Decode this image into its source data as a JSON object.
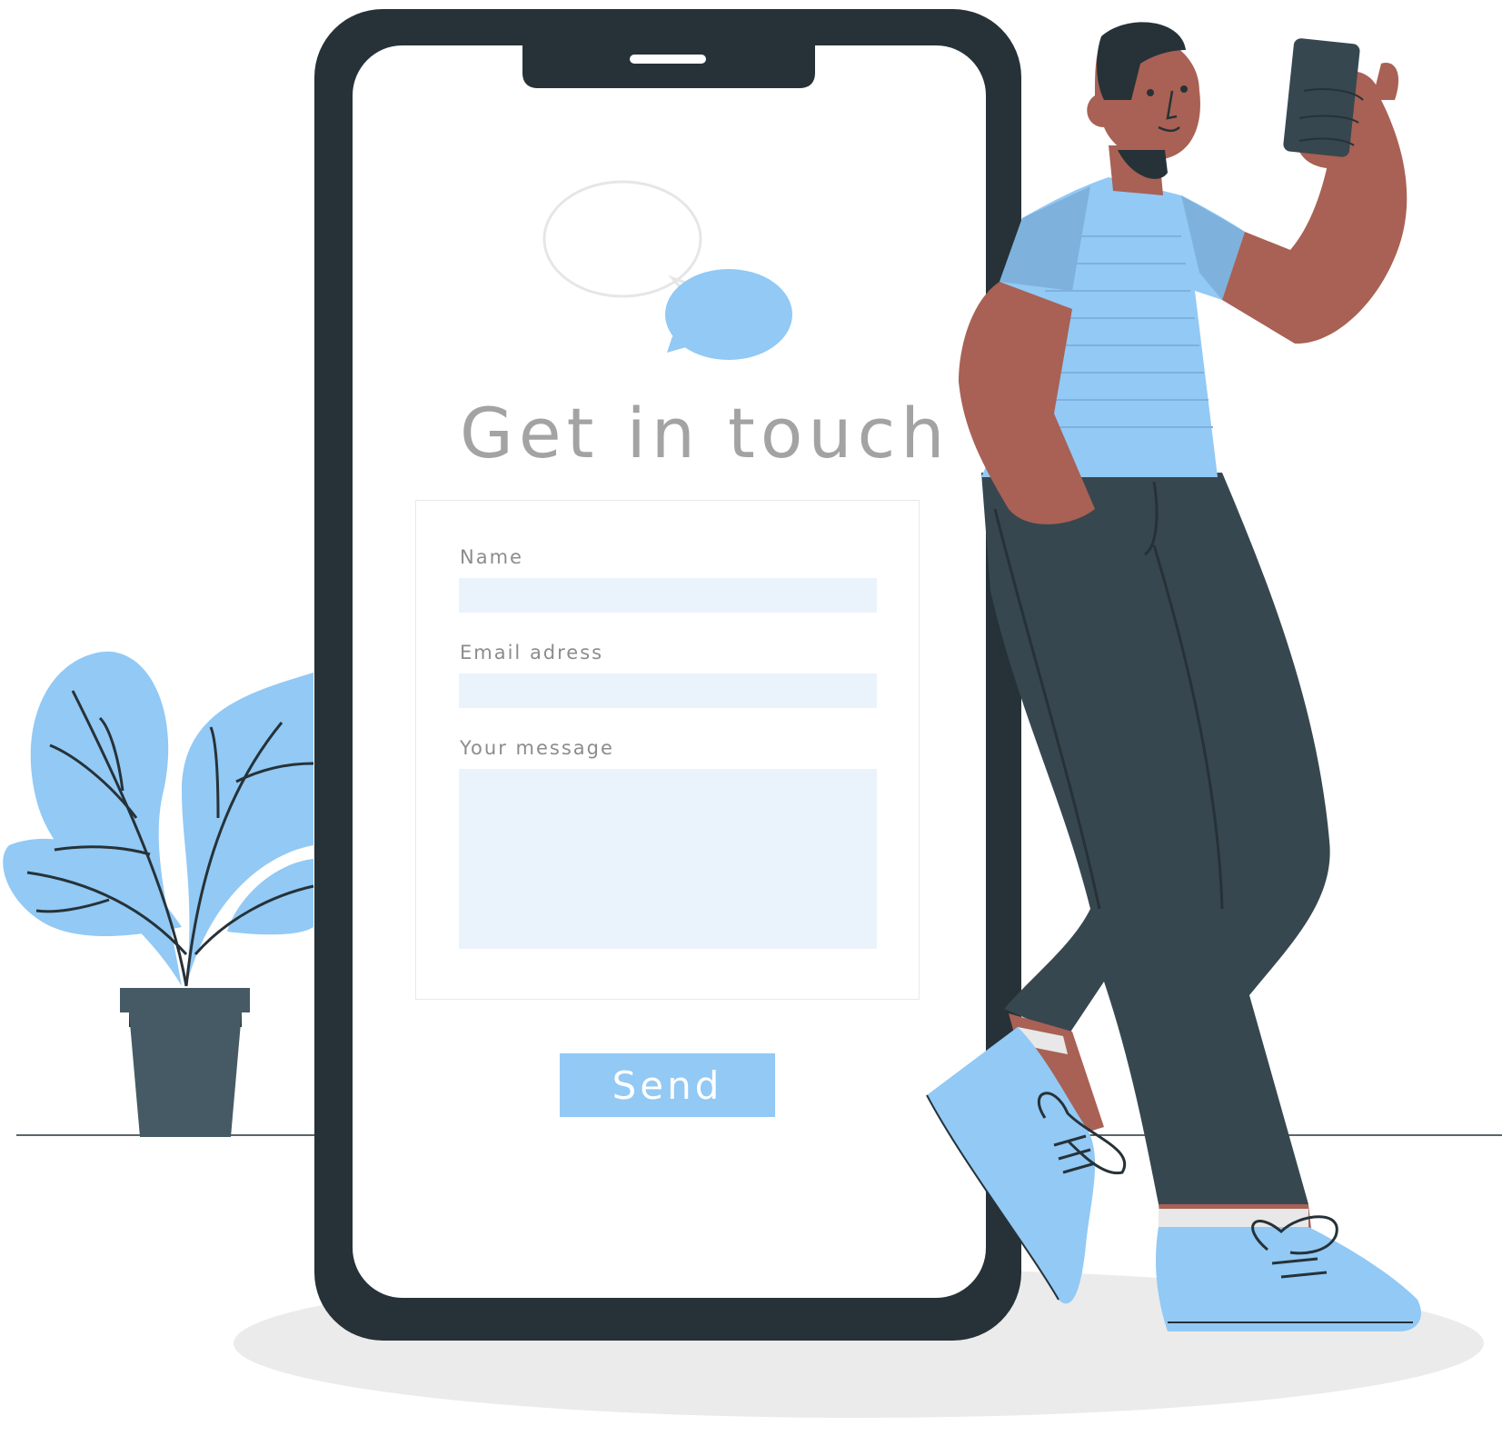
{
  "form": {
    "title": "Get in touch",
    "fields": [
      {
        "label": "Name",
        "value": ""
      },
      {
        "label": "Email adress",
        "value": ""
      },
      {
        "label": "Your message",
        "value": ""
      }
    ],
    "submit_label": "Send"
  },
  "colors": {
    "accent_blue": "#92c9f5",
    "field_background": "#eaf3fc",
    "phone_frame": "#263238",
    "title_gray": "#a3a3a3",
    "skin": "#a86154",
    "pants": "#37474f"
  },
  "icons": {
    "chat_bubbles": "chat-bubbles-icon"
  }
}
